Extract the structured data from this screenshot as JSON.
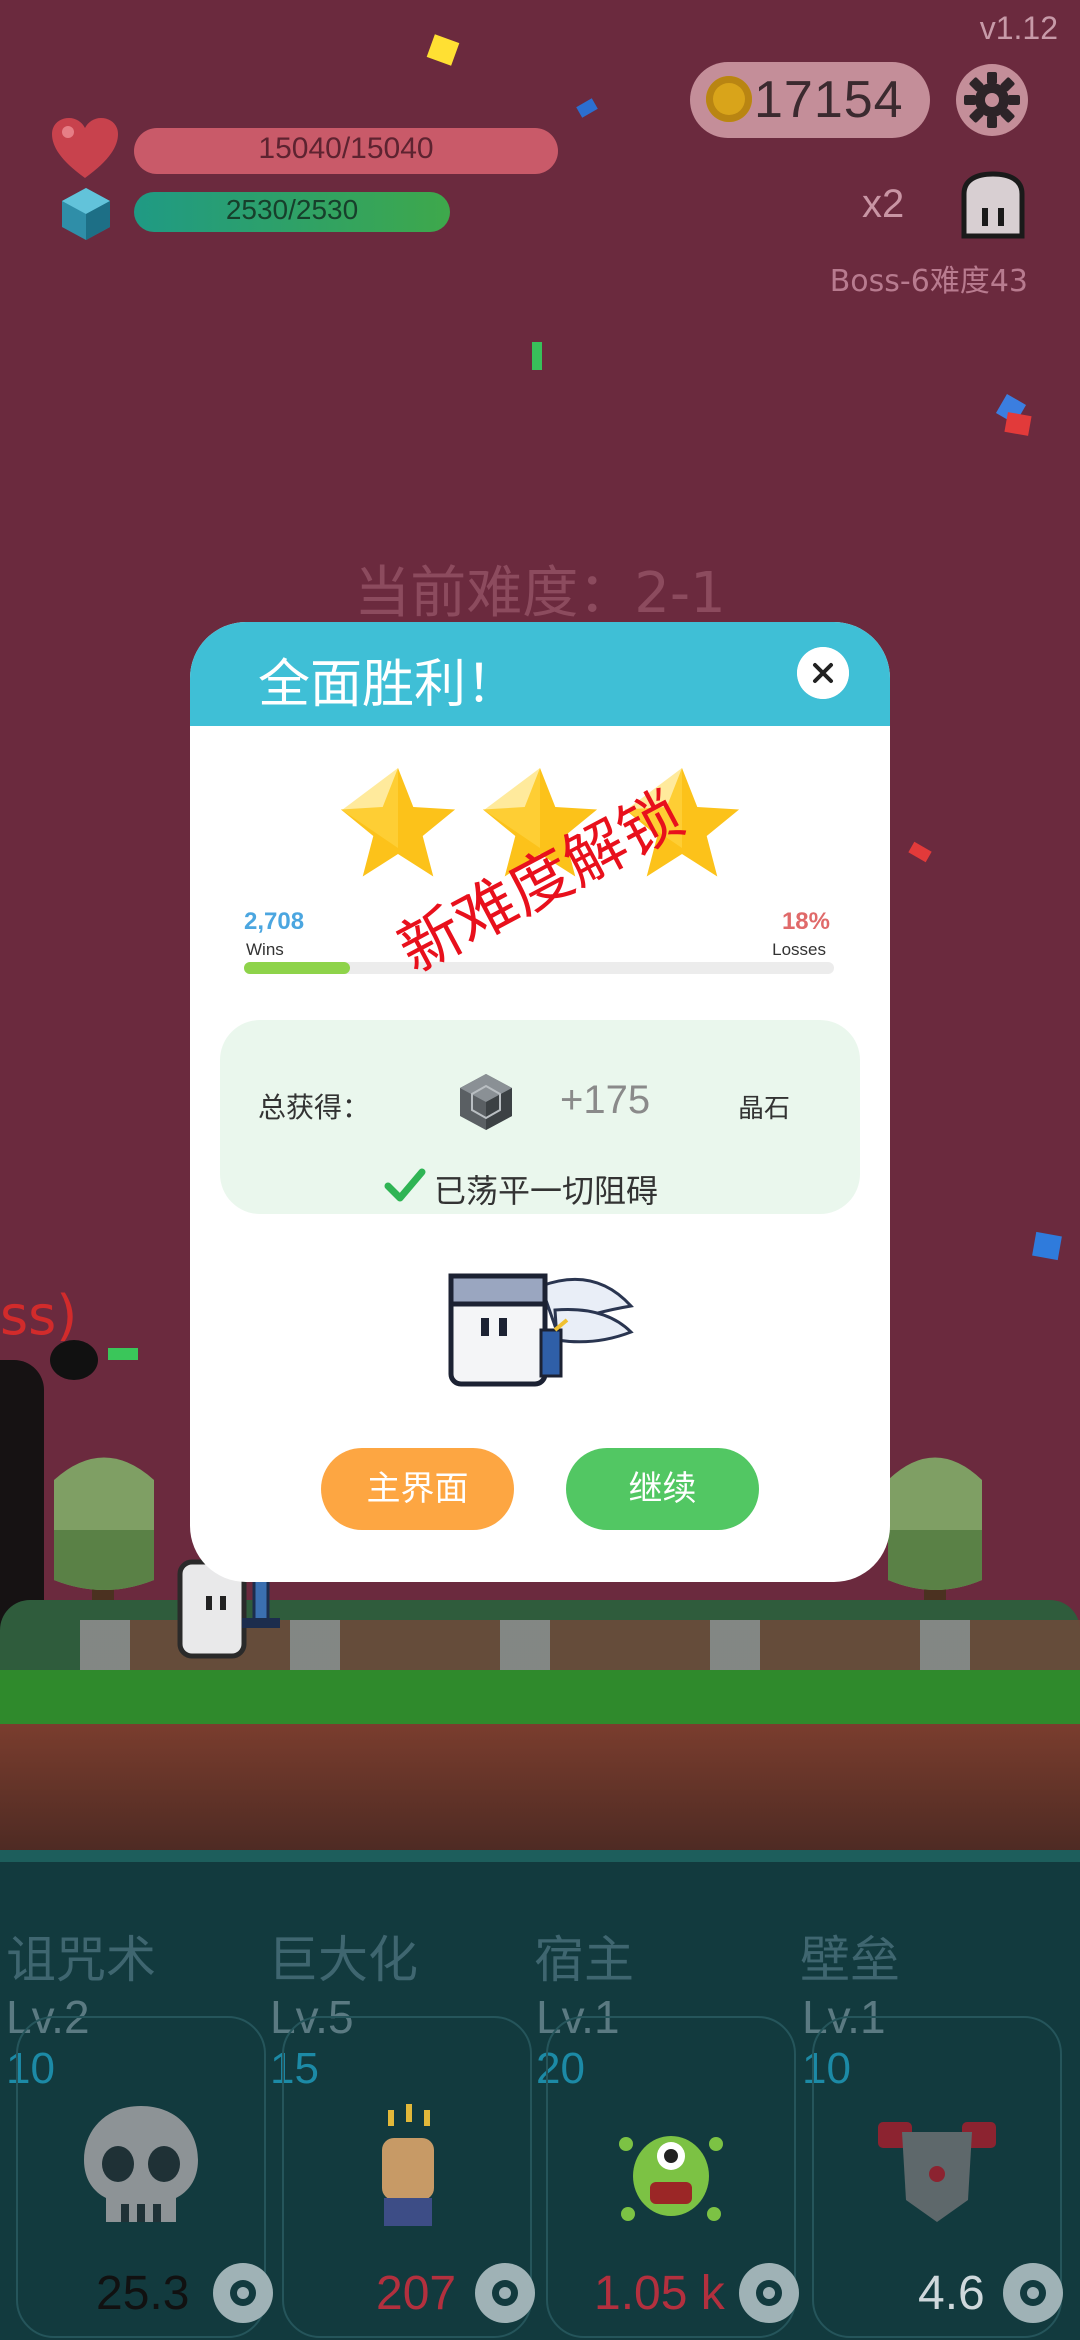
{
  "hud": {
    "version": "v1.12",
    "coins": "17154",
    "hp_text": "15040/15040",
    "mp_text": "2530/2530",
    "speed_multiplier": "x2",
    "boss_label": "Boss-6难度43"
  },
  "stage": {
    "current_difficulty": "当前难度：2-1",
    "enemy_partial_label": "ss)"
  },
  "dialog": {
    "title": "全面胜利！",
    "stars_earned": 3,
    "wins_value": "2,708",
    "wins_label": "Wins",
    "losses_value": "18%",
    "losses_label": "Losses",
    "progress_fraction": 0.18,
    "unlock_stamp": "新难度解锁",
    "total_label": "总获得：",
    "reward_amount": "+175",
    "reward_unit": "晶石",
    "cleared_text": "已荡平一切阻碍",
    "home_button": "主界面",
    "continue_button": "继续"
  },
  "skills": [
    {
      "name": "诅咒术",
      "level": "Lv.2",
      "cost": "10",
      "value": "25.3",
      "value_color": "#111111",
      "icon": "skull-icon"
    },
    {
      "name": "巨大化",
      "level": "Lv.5",
      "cost": "15",
      "value": "207",
      "value_color": "#b3303e",
      "icon": "fist-icon"
    },
    {
      "name": "宿主",
      "level": "Lv.1",
      "cost": "20",
      "value": "1.05 k",
      "value_color": "#b3303e",
      "icon": "monster-icon"
    },
    {
      "name": "壁垒",
      "level": "Lv.1",
      "cost": "10",
      "value": "4.6",
      "value_color": "#cfd8dc",
      "icon": "armor-icon"
    }
  ],
  "colors": {
    "background": "#6b2a3e",
    "dialog_header": "#3fbfd6",
    "home_button": "#fda642",
    "continue_button": "#52c763",
    "stamp": "#e8101c"
  }
}
